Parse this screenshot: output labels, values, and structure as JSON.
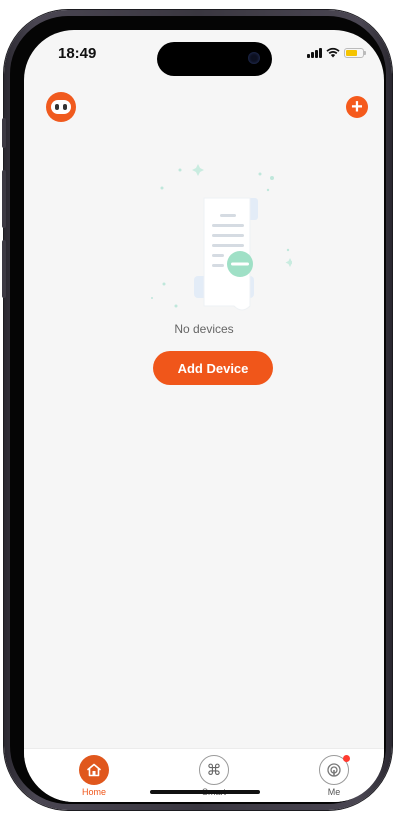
{
  "status_bar": {
    "time": "18:49"
  },
  "header": {
    "avatar_icon": "robot-avatar-icon",
    "add_icon": "plus-icon",
    "add_symbol": "+"
  },
  "empty_state": {
    "illustration": "empty-document-icon",
    "message": "No devices",
    "add_device_label": "Add Device"
  },
  "tab_bar": {
    "tabs": [
      {
        "label": "Home",
        "icon": "home-icon",
        "active": true
      },
      {
        "label": "Smart",
        "icon": "command-icon",
        "active": false
      },
      {
        "label": "Me",
        "icon": "profile-icon",
        "active": false
      }
    ]
  },
  "colors": {
    "accent": "#f0561a",
    "background": "#f6f6f6",
    "illustration_green": "#9fe0c6"
  }
}
